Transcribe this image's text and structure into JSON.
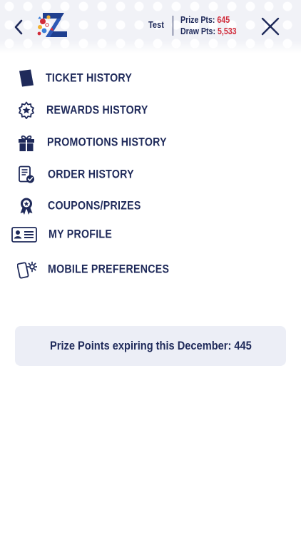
{
  "header": {
    "user_name": "Test",
    "prize_pts_label": "Prize Pts:",
    "prize_pts_value": "645",
    "draw_pts_label": "Draw Pts:",
    "draw_pts_value": "5,533",
    "back_icon": "chevron-left-icon",
    "close_icon": "close-icon",
    "accent_color": "#d12b3a",
    "primary_color": "#1f2a5a"
  },
  "menu": {
    "items": [
      {
        "label": "TICKET HISTORY",
        "icon": "ticket-icon"
      },
      {
        "label": "REWARDS HISTORY",
        "icon": "star-badge-icon"
      },
      {
        "label": "PROMOTIONS HISTORY",
        "icon": "gift-icon"
      },
      {
        "label": "ORDER HISTORY",
        "icon": "order-document-icon"
      },
      {
        "label": "COUPONS/PRIZES",
        "icon": "award-ribbon-icon"
      },
      {
        "label": "MY PROFILE",
        "icon": "id-card-icon"
      },
      {
        "label": "MOBILE PREFERENCES",
        "icon": "phone-settings-icon"
      }
    ]
  },
  "notice": {
    "text": "Prize Points expiring this December: 445"
  }
}
